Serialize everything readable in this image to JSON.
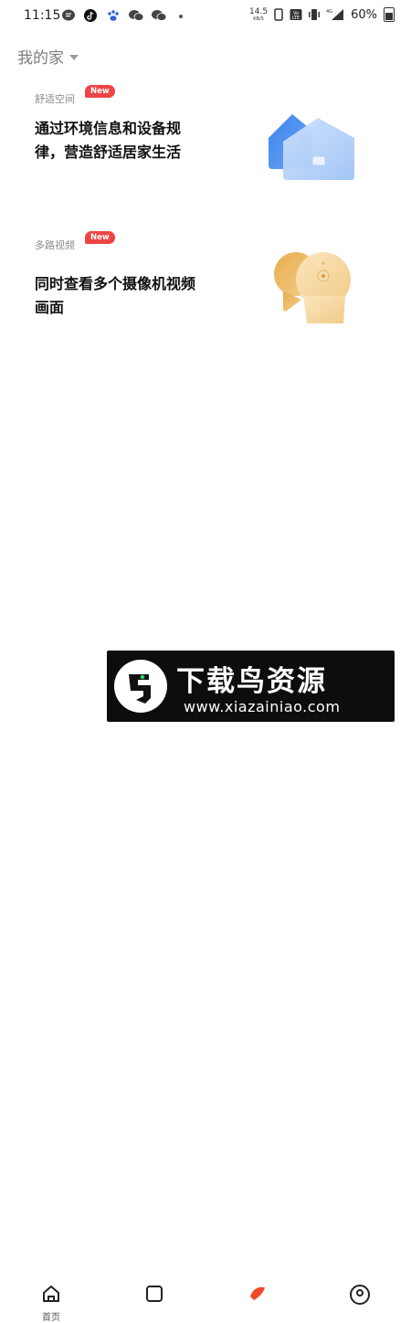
{
  "status": {
    "time": "11:15",
    "net_speed_value": "14.5",
    "net_speed_unit": "KB/S",
    "battery": "60%",
    "signal_label": "4G"
  },
  "home": {
    "name": "我的家"
  },
  "cards": [
    {
      "label": "舒适空间",
      "badge": "New",
      "title": "通过环境信息和设备规律，营造舒适居家生活"
    },
    {
      "label": "多路视频",
      "badge": "New",
      "title": "同时查看多个摄像机视频画面"
    }
  ],
  "nav": {
    "home_label": "首页"
  },
  "watermark": {
    "title": "下载鸟资源",
    "url": "www.xiazainiao.com"
  },
  "colors": {
    "badge": "#ef4444",
    "house_blue": "#4e8ff0",
    "camera_gold": "#e9b561",
    "text": "#111111"
  }
}
